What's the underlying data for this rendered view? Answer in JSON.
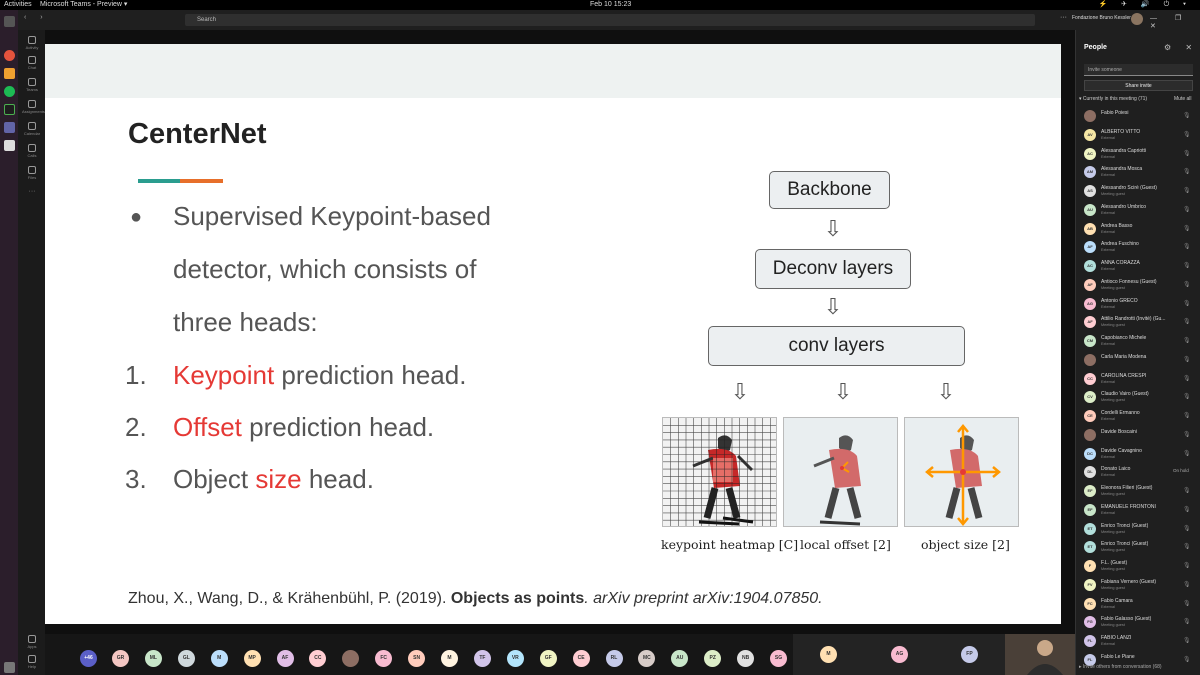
{
  "os": {
    "activities": "Activities",
    "app": "Microsoft Teams - Preview ▾",
    "clock": "Feb 10  15:23",
    "tray": "⚡ ✈ 🔊 ⏻ ▾"
  },
  "titlebar": {
    "nav": "‹ ›",
    "search_placeholder": "Search",
    "dots": "···",
    "org": "Fondazione Bruno Kessler",
    "window_controls": "— ❐ ✕"
  },
  "rail": [
    {
      "label": "Activity"
    },
    {
      "label": "Chat"
    },
    {
      "label": "Teams"
    },
    {
      "label": "Assignments"
    },
    {
      "label": "Calendar"
    },
    {
      "label": "Calls"
    },
    {
      "label": "Files"
    },
    {
      "label": "···"
    }
  ],
  "rail_bottom": [
    {
      "label": "Apps"
    },
    {
      "label": "Help"
    }
  ],
  "slide": {
    "title": "CenterNet",
    "bullet": "●",
    "line1": "Supervised Keypoint-based",
    "line2": "detector, which consists of",
    "line3": "three heads:",
    "items": [
      {
        "num": "1.",
        "hl": "Keypoint",
        "rest": " prediction head."
      },
      {
        "num": "2.",
        "hl": "Offset",
        "rest": " prediction head."
      },
      {
        "num": "3.",
        "pre": "Object ",
        "hl": "size",
        "rest": " head."
      }
    ],
    "diagram": {
      "backbone": "Backbone",
      "deconv": "Deconv layers",
      "conv": "conv layers",
      "arrow": "⇩",
      "captions": [
        "keypoint heatmap [C]",
        "local offset [2]",
        "object size [2]"
      ]
    },
    "citation": {
      "authors": "Zhou, X., Wang, D., & Krähenbühl, P. (2019). ",
      "title": "Objects as points",
      "venue": ". arXiv preprint arXiv:1904.07850."
    }
  },
  "strip": {
    "overflow": "+46",
    "avatars": [
      "GR",
      "ML",
      "GL",
      "M",
      "MP",
      "AF",
      "CC",
      "",
      "FC",
      "SN",
      "M",
      "TF",
      "VR",
      "GF",
      "CE",
      "RL",
      "MC",
      "AU",
      "PZ",
      "NB",
      "SG"
    ],
    "tiles": [
      "M",
      "AG",
      "FP"
    ],
    "colors": [
      "#f4c7c3",
      "#c8e6c9",
      "#cfd8dc",
      "#bbdefb",
      "#ffe0b2",
      "#e1bee7",
      "#ffcdd2",
      "#8d6e63",
      "#f8bbd0",
      "#ffccbc",
      "#fff3e0",
      "#d1c4e9",
      "#b3e5fc",
      "#f0f4c3",
      "#ffcdd2",
      "#c5cae9",
      "#d7ccc8",
      "#c8e6c9",
      "#dcedc8",
      "#e0e0e0",
      "#f8bbd0"
    ]
  },
  "people": {
    "title": "People",
    "icons": "⚙ ✕",
    "invite_placeholder": "Invite someone",
    "share": "Share invite",
    "section": "▾ Currently in this meeting (71)",
    "mute_all": "Mute all",
    "mic": "🎙",
    "footer": "▸ Invite others from conversation (68)",
    "list": [
      {
        "name": "Fabio Poiesi",
        "sub": "",
        "av": "",
        "color": "#8d6e63"
      },
      {
        "name": "ALBERTO VITTO",
        "sub": "External",
        "av": "AV",
        "color": "#f5e6a3"
      },
      {
        "name": "Alessandra Capriotti",
        "sub": "External",
        "av": "AC",
        "color": "#f0f4c3"
      },
      {
        "name": "Alessandra Mosca",
        "sub": "External",
        "av": "AM",
        "color": "#c5cae9"
      },
      {
        "name": "Alessandro Scirè (Guest)",
        "sub": "Meeting guest",
        "av": "AS",
        "color": "#e0e0e0"
      },
      {
        "name": "Alessandro Umbrico",
        "sub": "External",
        "av": "AU",
        "color": "#c8e6c9"
      },
      {
        "name": "Andrea Basso",
        "sub": "External",
        "av": "AB",
        "color": "#ffe0b2"
      },
      {
        "name": "Andrea Fuschino",
        "sub": "External",
        "av": "AF",
        "color": "#bbdefb"
      },
      {
        "name": "ANNA CORAZZA",
        "sub": "External",
        "av": "AC",
        "color": "#b2dfdb"
      },
      {
        "name": "Antioco Fonnesu (Guest)",
        "sub": "Meeting guest",
        "av": "AF",
        "color": "#ffccbc"
      },
      {
        "name": "Antonio GRECO",
        "sub": "External",
        "av": "AG",
        "color": "#f8bbd0"
      },
      {
        "name": "Attilio Randrotti (Invité) (Gu...",
        "sub": "Meeting guest",
        "av": "AF",
        "color": "#ffcdd2"
      },
      {
        "name": "Capobianco Michele",
        "sub": "External",
        "av": "CM",
        "color": "#c8e6c9"
      },
      {
        "name": "Carla Maria Modena",
        "sub": "",
        "av": "",
        "color": "#8d6e63"
      },
      {
        "name": "CAROLINA CRESPI",
        "sub": "External",
        "av": "CC",
        "color": "#ffcdd2"
      },
      {
        "name": "Claudio Vairo (Guest)",
        "sub": "Meeting guest",
        "av": "CV",
        "color": "#dcedc8"
      },
      {
        "name": "Cordelli Ermanno",
        "sub": "External",
        "av": "CE",
        "color": "#ffccbc"
      },
      {
        "name": "Davide Boscaini",
        "sub": "",
        "av": "",
        "color": "#8d6e63"
      },
      {
        "name": "Davide Cavagnino",
        "sub": "External",
        "av": "DC",
        "color": "#bbdefb"
      },
      {
        "name": "Donato Laico",
        "sub": "External",
        "av": "DL",
        "color": "#e0e0e0",
        "hold": "On hold"
      },
      {
        "name": "Eleonora Filieri (Guest)",
        "sub": "Meeting guest",
        "av": "EF",
        "color": "#dcedc8"
      },
      {
        "name": "EMANUELE FRONTONI",
        "sub": "External",
        "av": "EF",
        "color": "#c8e6c9"
      },
      {
        "name": "Enrico Tronci (Guest)",
        "sub": "Meeting guest",
        "av": "ET",
        "color": "#b2dfdb"
      },
      {
        "name": "Enrico Tronci (Guest)",
        "sub": "Meeting guest",
        "av": "ET",
        "color": "#b2dfdb"
      },
      {
        "name": "F.L. (Guest)",
        "sub": "Meeting guest",
        "av": "F",
        "color": "#ffe0b2"
      },
      {
        "name": "Fabiana Vernero (Guest)",
        "sub": "Meeting guest",
        "av": "FV",
        "color": "#f0f4c3"
      },
      {
        "name": "Fabio Camara",
        "sub": "External",
        "av": "FC",
        "color": "#ffe0b2"
      },
      {
        "name": "Fabio Galasso (Guest)",
        "sub": "Meeting guest",
        "av": "FG",
        "color": "#e1bee7"
      },
      {
        "name": "FABIO LANZI",
        "sub": "External",
        "av": "FL",
        "color": "#d1c4e9"
      },
      {
        "name": "Fabio Le Piane",
        "sub": "",
        "av": "FL",
        "color": "#c5cae9"
      }
    ]
  }
}
